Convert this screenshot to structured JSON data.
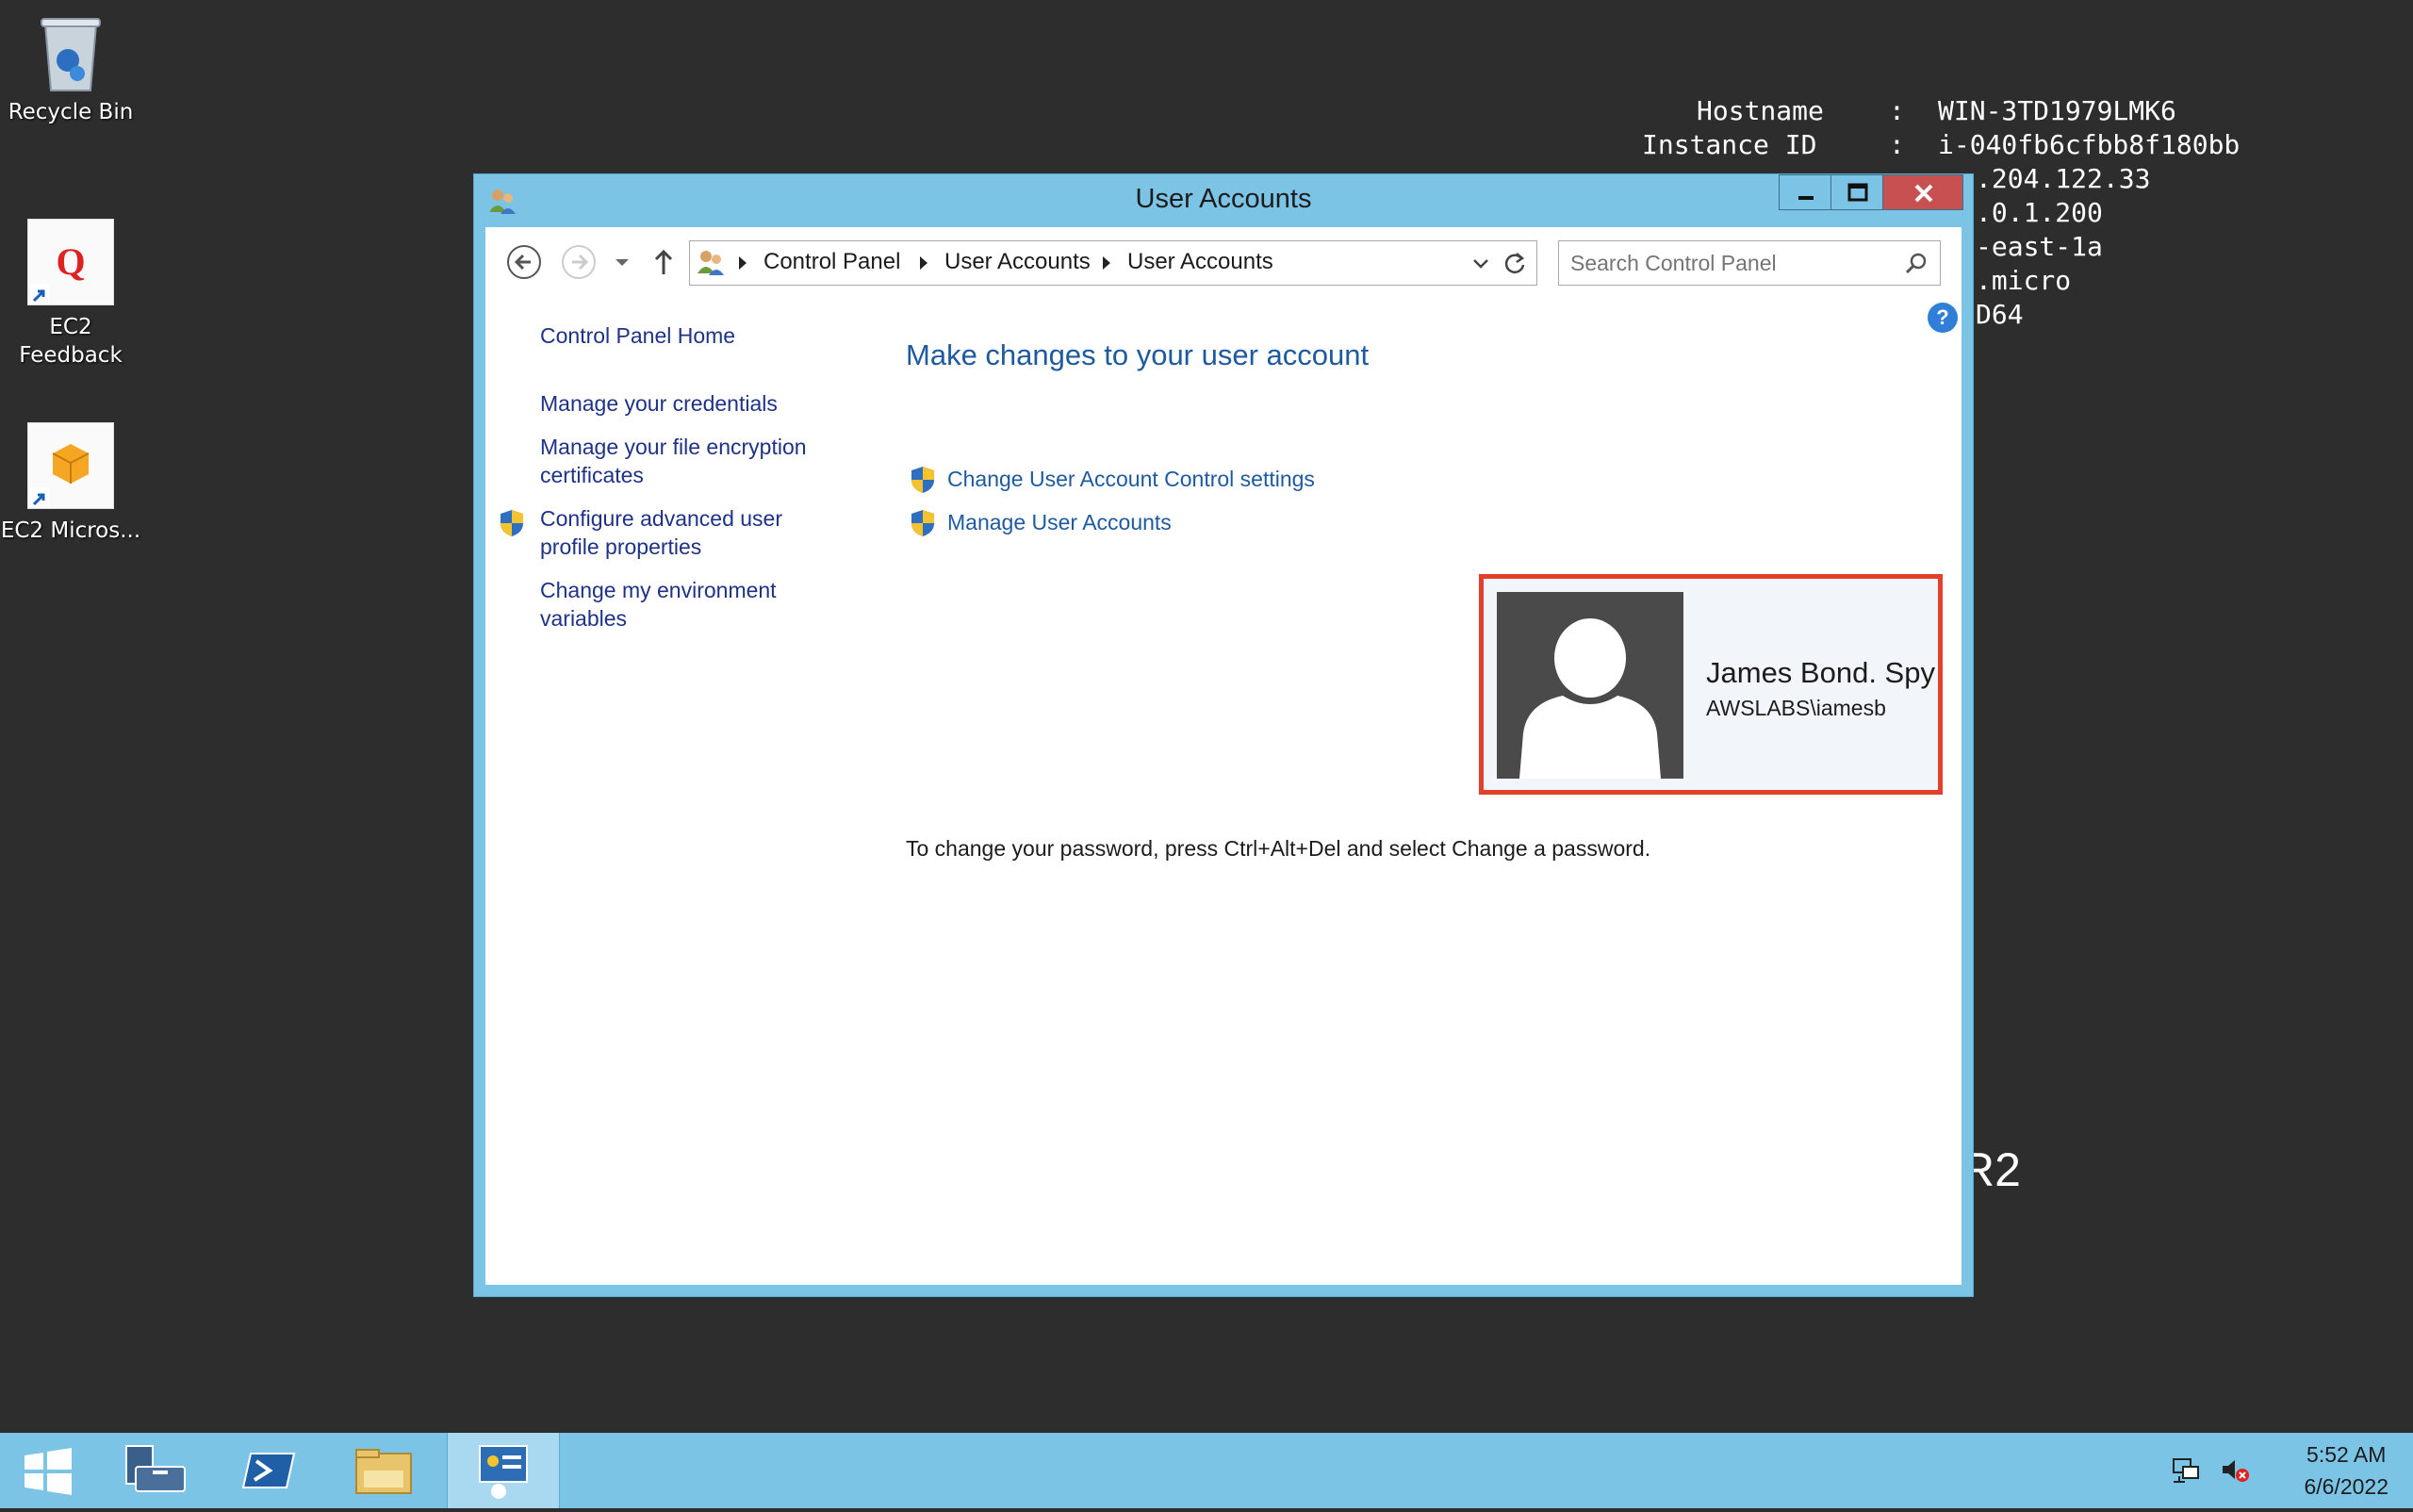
{
  "desktop": {
    "icons": [
      {
        "label": "Recycle Bin",
        "icon": "recycle-bin-icon"
      },
      {
        "label": "EC2 Feedback",
        "icon": "ec2-feedback-icon"
      },
      {
        "label": "EC2 Micros...",
        "icon": "ec2-microsoft-windows-guide-icon"
      }
    ],
    "bginfo": {
      "hostname_label": "Hostname",
      "hostname": "WIN-3TD1979LMK6",
      "instance_label": "Instance ID",
      "instance_id": "i-040fb6cfbb8f180bb",
      "partial_lines": [
        ".204.122.33",
        ".0.1.200",
        "-east-1a",
        ".micro",
        "D64"
      ],
      "os_fragment": "R2",
      "separator": ":"
    }
  },
  "window": {
    "title": "User Accounts",
    "buttons": {
      "minimize": "minimize-icon",
      "maximize": "maximize-icon",
      "close": "close-icon"
    },
    "address": {
      "crumbs": [
        "Control Panel",
        "User Accounts",
        "User Accounts"
      ]
    },
    "search": {
      "placeholder": "Search Control Panel"
    },
    "left_pane": [
      {
        "label": "Control Panel Home",
        "shield": false
      },
      {
        "label": "Manage your credentials",
        "shield": false
      },
      {
        "label": "Manage your file encryption certificates",
        "shield": false
      },
      {
        "label": "Configure advanced user profile properties",
        "shield": true
      },
      {
        "label": "Change my environment variables",
        "shield": false
      }
    ],
    "main": {
      "heading": "Make changes to your user account",
      "links": [
        {
          "label": "Change User Account Control settings",
          "shield": true
        },
        {
          "label": "Manage User Accounts",
          "shield": true
        }
      ],
      "user": {
        "name": "James Bond. Spy",
        "id": "AWSLABS\\iamesb"
      },
      "password_hint": "To change your password, press Ctrl+Alt+Del and select Change a password."
    }
  },
  "taskbar": {
    "buttons": [
      "start-icon",
      "server-manager-icon",
      "powershell-icon",
      "file-explorer-icon",
      "control-panel-icon"
    ],
    "active": "control-panel-icon",
    "clock": {
      "time": "5:52 AM",
      "date": "6/6/2022"
    },
    "tray": [
      "network-icon",
      "volume-muted-icon"
    ]
  },
  "colors": {
    "accent": "#7cc4e6",
    "link": "#1e5aa0",
    "highlight_border": "#e2402b",
    "close_button": "#c75050",
    "desktop": "#2d2d2d"
  }
}
